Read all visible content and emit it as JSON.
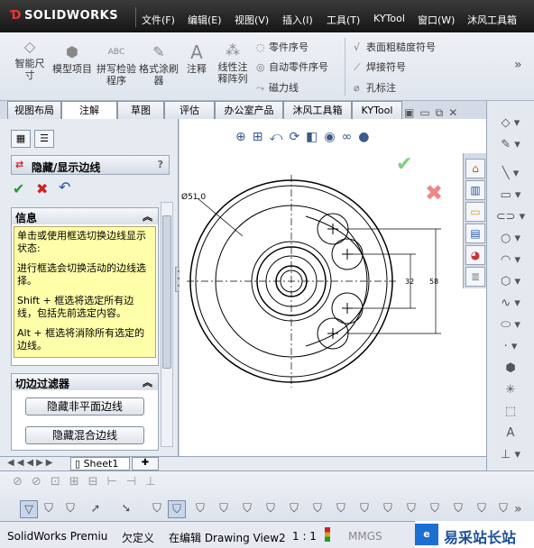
{
  "app": {
    "logo": "SOLIDWORKS"
  },
  "menu": [
    {
      "label": "文件(F)"
    },
    {
      "label": "编辑(E)"
    },
    {
      "label": "视图(V)"
    },
    {
      "label": "插入(I)"
    },
    {
      "label": "工具(T)"
    },
    {
      "label": "KYTool"
    },
    {
      "label": "窗口(W)"
    },
    {
      "label": "沐风工具箱"
    }
  ],
  "ribbon": {
    "smart_dim": "智能尺寸",
    "model_items": "模型项目",
    "spell_check": "拼写检验程序",
    "format_painter": "格式涂刷器",
    "note": "注释",
    "linear_pattern": "线性注释阵列",
    "balloon": "零件序号",
    "auto_balloon": "自动零件序号",
    "magnetic_line": "磁力线",
    "surface_finish": "表面粗糙度符号",
    "weld_symbol": "焊接符号",
    "hole_callout": "孔标注"
  },
  "tabs": [
    {
      "label": "视图布局"
    },
    {
      "label": "注解"
    },
    {
      "label": "草图"
    },
    {
      "label": "评估"
    },
    {
      "label": "办公室产品"
    },
    {
      "label": "沐风工具箱"
    },
    {
      "label": "KYTool"
    }
  ],
  "panel": {
    "title": "隐藏/显示边线",
    "help": "?",
    "info": {
      "header": "信息",
      "p1": "单击或使用框选切换边线显示状态:",
      "p2": "进行框选会切换活动的边线选择。",
      "p3": "Shift + 框选将选定所有边线，包括先前选定内容。",
      "p4": "Alt + 框选将消除所有选定的边线。"
    },
    "filter": {
      "header": "切边过滤器",
      "btn1": "隐藏非平面边线",
      "btn2": "隐藏混合边线"
    }
  },
  "drawing": {
    "dim_dia": "Ø51.0",
    "dim_32": "32",
    "dim_58": "58"
  },
  "sheet_tab": "Sheet1",
  "status": {
    "product": "SolidWorks Premiu",
    "undefined": "欠定义",
    "editing": "在编辑 Drawing View2",
    "scale": "1 : 1",
    "units": "MMGS"
  },
  "watermark": {
    "text": "易采站长站"
  },
  "colors": {
    "accent_red": "#cc2222",
    "check_green": "#2a9a2a",
    "yellow_info": "#ffffaa"
  }
}
